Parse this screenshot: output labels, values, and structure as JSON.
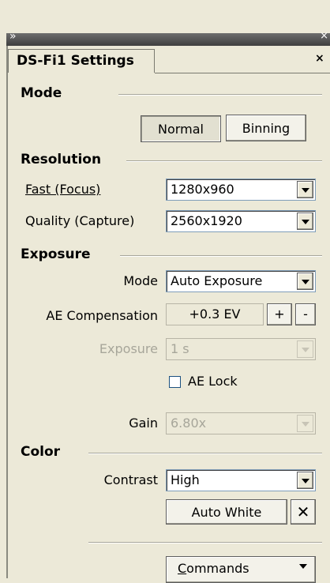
{
  "panel": {
    "expand_glyph": "»",
    "strip_close_glyph": "×",
    "tab_title": "DS-Fi1 Settings",
    "close_glyph": "×"
  },
  "mode": {
    "heading": "Mode",
    "normal_label": "Normal",
    "binning_label": "Binning",
    "selected": "Normal"
  },
  "resolution": {
    "heading": "Resolution",
    "fast_label": "Fast (Focus)",
    "fast_value": "1280x960",
    "quality_label": "Quality (Capture)",
    "quality_value": "2560x1920"
  },
  "exposure": {
    "heading": "Exposure",
    "mode_label": "Mode",
    "mode_value": "Auto Exposure",
    "ae_comp_label": "AE Compensation",
    "ae_comp_value": "+0.3 EV",
    "plus_label": "+",
    "minus_label": "-",
    "exposure_label": "Exposure",
    "exposure_value": "1 s",
    "ae_lock_label": "AE Lock",
    "ae_lock_checked": false,
    "gain_label": "Gain",
    "gain_value": "6.80x"
  },
  "color": {
    "heading": "Color",
    "contrast_label": "Contrast",
    "contrast_value": "High",
    "auto_white_label": "Auto White",
    "auto_white_close_glyph": "✕"
  },
  "commands": {
    "label_first": "C",
    "label_rest": "ommands"
  }
}
